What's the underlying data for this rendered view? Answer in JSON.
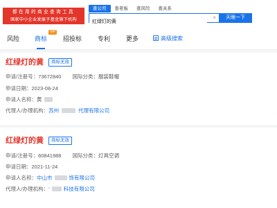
{
  "header": {
    "brand_line1": "都在用的商业查询工具",
    "brand_line2": "国家中小企业发展子基金旗下机构",
    "search_tabs": [
      "查公司",
      "查老板",
      "查风险",
      "查关系"
    ],
    "search_value": "红绿灯的黄",
    "search_button": "天眼一下"
  },
  "nav": {
    "items": [
      "风险",
      "商标",
      "招投标",
      "专利",
      "更多"
    ],
    "active": "商标",
    "vip_badge": "VIP",
    "advanced_search": "高级搜索"
  },
  "results": [
    {
      "name": "红绿灯的黄",
      "status": "商标无效",
      "reg_label": "申请/注册号：",
      "reg_no": "73672840",
      "class_label": "国际分类：",
      "class_value": "服装鞋帽",
      "date_label": "申请日期：",
      "date": "2023-08-24",
      "applicant_label": "申请人名称：",
      "applicant": "黄",
      "agent_label": "代理人/办理机构：",
      "agent_prefix": "苏州",
      "agent_suffix": "代理有限公司"
    },
    {
      "name": "红绿灯的黄",
      "status": "商标无效",
      "reg_label": "申请/注册号：",
      "reg_no": "60841988",
      "class_label": "国际分类：",
      "class_value": "灯具空调",
      "date_label": "申请日期：",
      "date": "2021-11-24",
      "applicant_label": "申请人名称：",
      "applicant_prefix": "中山市",
      "applicant_suffix": "饰有限公司",
      "agent_label": "代理人/办理机构：",
      "agent_prefix": "‘",
      "agent_suffix": "科技有限公司"
    }
  ]
}
